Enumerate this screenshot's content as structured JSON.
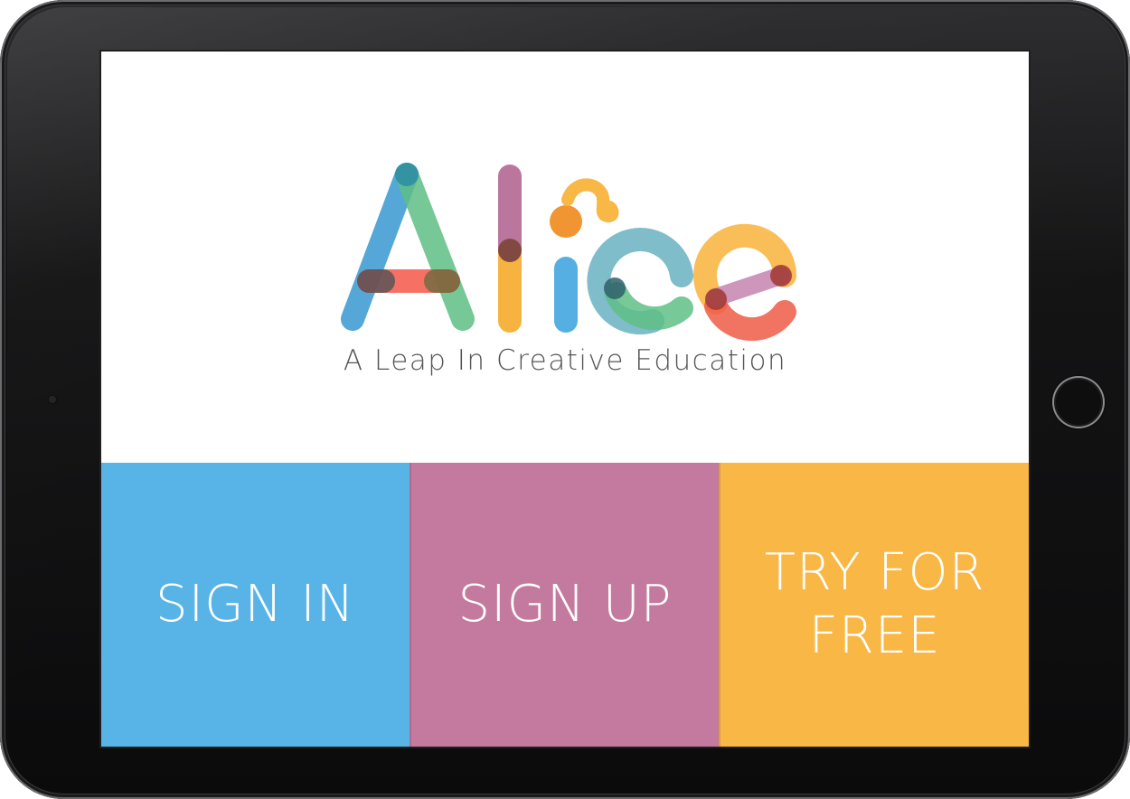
{
  "app": {
    "logo_text": "Alice",
    "tagline": "A Leap In Creative Education"
  },
  "actions": [
    {
      "label": "SIGN IN",
      "color": "#58b4e6"
    },
    {
      "label": "SIGN UP",
      "color": "#c47a9e"
    },
    {
      "label": "TRY FOR\nFREE",
      "color": "#f9b746"
    }
  ],
  "icons": {
    "camera": "front-camera-icon",
    "home": "home-button-icon"
  }
}
